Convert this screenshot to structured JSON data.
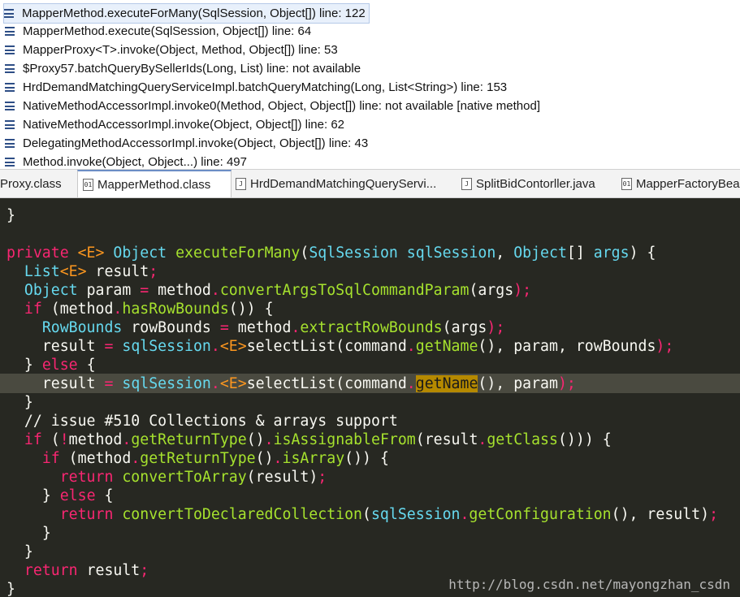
{
  "stack_frames": [
    "MapperMethod.executeForMany(SqlSession, Object[]) line: 122",
    "MapperMethod.execute(SqlSession, Object[]) line: 64",
    "MapperProxy<T>.invoke(Object, Method, Object[]) line: 53",
    "$Proxy57.batchQueryBySellerIds(Long, List) line: not available",
    "HrdDemandMatchingQueryServiceImpl.batchQueryMatching(Long, List<String>) line: 153",
    "NativeMethodAccessorImpl.invoke0(Method, Object, Object[]) line: not available [native method]",
    "NativeMethodAccessorImpl.invoke(Object, Object[]) line: 62",
    "DelegatingMethodAccessorImpl.invoke(Object, Object[]) line: 43",
    "Method.invoke(Object, Object...) line: 497"
  ],
  "tabs": [
    "Proxy.class",
    "MapperMethod.class",
    "HrdDemandMatchingQueryServi...",
    "SplitBidContorller.java",
    "MapperFactoryBean"
  ],
  "code": {
    "l0": "}",
    "l1": [
      "private",
      "<E>",
      "Object",
      "executeForMany",
      "(",
      "SqlSession",
      "sqlSession",
      ",",
      "Object",
      "[]",
      "args",
      ") {"
    ],
    "l2": [
      "List",
      "<E>",
      "result",
      ";"
    ],
    "l3": [
      "Object",
      "param",
      "=",
      "method",
      ".",
      "convertArgsToSqlCommandParam",
      "(",
      "args",
      ");"
    ],
    "l4": [
      "if",
      "(",
      "method",
      ".",
      "hasRowBounds",
      "()) {"
    ],
    "l5": [
      "RowBounds",
      "rowBounds",
      "=",
      "method",
      ".",
      "extractRowBounds",
      "(",
      "args",
      ");"
    ],
    "l6": [
      "result",
      "=",
      "sqlSession",
      ".",
      "<E>",
      "selectList",
      "(command",
      ".",
      "getName",
      "(), param, rowBounds",
      ");"
    ],
    "l7": [
      "}",
      "else",
      "{"
    ],
    "l8": [
      "result",
      "=",
      "sqlSession",
      ".",
      "<E>",
      "selectList",
      "(command",
      ".",
      "getName",
      "(), param",
      ");"
    ],
    "l9": "}",
    "l10": "// issue #510 Collections & arrays support",
    "l11": [
      "if",
      "(",
      "!",
      "method",
      ".",
      "getReturnType",
      "()",
      ".",
      "isAssignableFrom",
      "(result",
      ".",
      "getClass",
      "())) {"
    ],
    "l12": [
      "if",
      "(method",
      ".",
      "getReturnType",
      "()",
      ".",
      "isArray",
      "()) {"
    ],
    "l13": [
      "return",
      "convertToArray",
      "(result)",
      ";"
    ],
    "l14": [
      "}",
      "else",
      "{"
    ],
    "l15": [
      "return",
      "convertToDeclaredCollection",
      "(",
      "sqlSession",
      ".",
      "getConfiguration",
      "(), result)",
      ";"
    ],
    "l16": "}",
    "l17": "}",
    "l18": [
      "return",
      "result",
      ";"
    ],
    "l19": "}"
  },
  "watermark": "http://blog.csdn.net/mayongzhan_csdn",
  "colors": {
    "keyword": "#f92672",
    "type": "#66d9ef",
    "function": "#a6e22e",
    "param": "#fd971f",
    "background": "#272822"
  }
}
